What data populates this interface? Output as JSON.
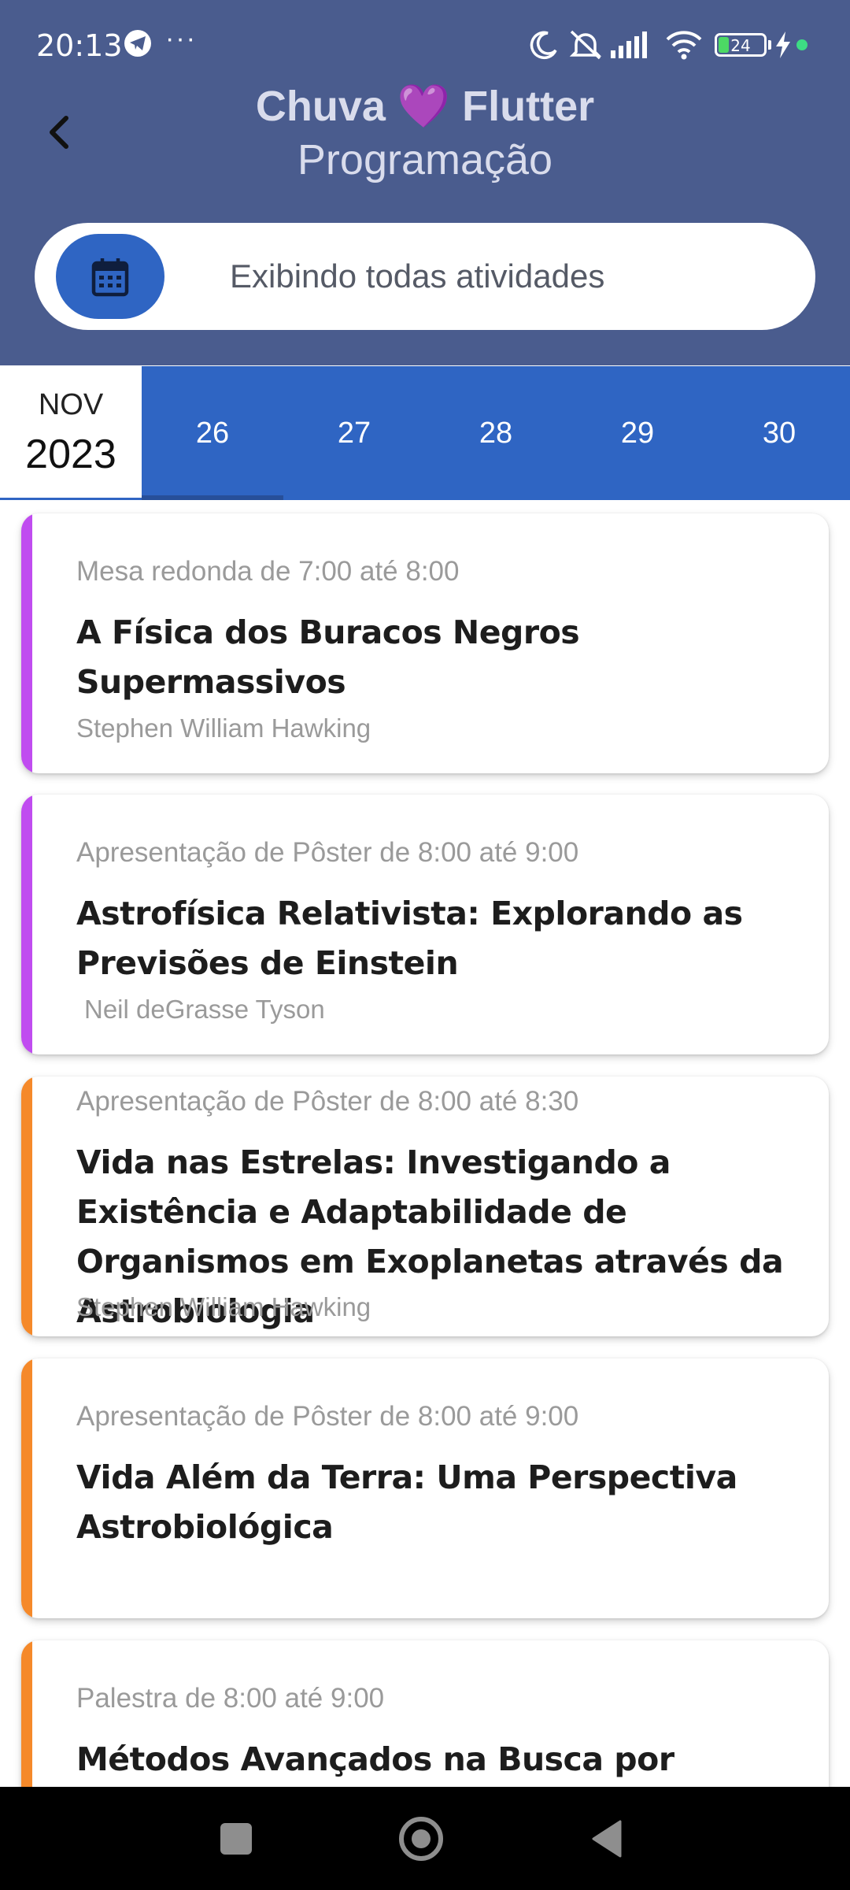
{
  "status_bar": {
    "time": "20:13",
    "more": "···",
    "battery": "24",
    "battery_level": 0.24,
    "icons": [
      "telegram-icon",
      "moon-icon",
      "vibrate-off-icon",
      "signal-icon",
      "wifi-icon",
      "battery-icon",
      "charging-icon"
    ]
  },
  "header": {
    "title": "Chuva 💜 Flutter",
    "subtitle": "Programação",
    "background": "#4a5c8e"
  },
  "filter": {
    "label": "Exibindo todas atividades",
    "button_color": "#2f65c3"
  },
  "date_bar": {
    "month": "NOV",
    "year": "2023",
    "days": [
      "26",
      "27",
      "28",
      "29",
      "30"
    ],
    "selected_day": "26",
    "accent": "#2f65c3"
  },
  "activities": [
    {
      "meta": "Mesa redonda de 7:00 até 8:00",
      "title": "A Física dos Buracos Negros Supermassivos",
      "speaker": "Stephen William Hawking",
      "color": "#c04cf0"
    },
    {
      "meta": "Apresentação de Pôster de 8:00 até 9:00",
      "title": "Astrofísica Relativista: Explorando as Previsões de Einstein",
      "speaker": "Neil deGrasse Tyson",
      "color": "#c04cf0"
    },
    {
      "meta": "Apresentação de Pôster de 8:00 até 8:30",
      "title": "Vida nas Estrelas: Investigando a Existência e Adaptabilidade de Organismos em Exoplanetas através da Astrobiologia",
      "speaker": "Stephen William Hawking",
      "color": "#f5892a"
    },
    {
      "meta": "Apresentação de Pôster de 8:00 até 9:00",
      "title": "Vida Além da Terra: Uma Perspectiva Astrobiológica",
      "speaker": "",
      "color": "#f5892a"
    },
    {
      "meta": "Palestra de 8:00 até 9:00",
      "title": "Métodos Avançados na Busca por Inteligência Extraterrestre",
      "speaker": "",
      "color": "#f5892a"
    }
  ],
  "nav_bar": {
    "icons": [
      "recents-square-icon",
      "home-circle-icon",
      "back-triangle-icon"
    ]
  }
}
